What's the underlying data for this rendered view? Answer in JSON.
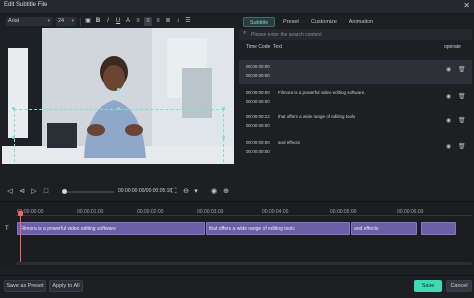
{
  "window": {
    "title": "Edit Subtitle File"
  },
  "toolbar": {
    "font": "Arial",
    "size": "24",
    "icons": [
      "bold-icon",
      "italic-icon",
      "underline-icon",
      "align-left-icon",
      "align-center-icon",
      "align-right-icon",
      "align-justify-icon",
      "text-style-icon",
      "color-icon"
    ]
  },
  "player": {
    "timecode": "00:00:00:00/00:00:05:16"
  },
  "tabs": [
    {
      "label": "Subtitle",
      "active": true
    },
    {
      "label": "Preset",
      "active": false
    },
    {
      "label": "Customize",
      "active": false
    },
    {
      "label": "Animation",
      "active": false
    }
  ],
  "search": {
    "placeholder": "Please enter the search content"
  },
  "list": {
    "header_time": "Time Code",
    "header_text": "Text",
    "header_op": "operate",
    "rows": [
      {
        "start": "00:00:00:00",
        "end": "00:00:00:00",
        "text": "",
        "selected": true
      },
      {
        "start": "00:00:00:00",
        "end": "00:00:00:00",
        "text": "Filmora is a powerful video editing software.",
        "selected": false
      },
      {
        "start": "00:00:00:22",
        "end": "00:00:00:00",
        "text": "that offers a wide range of editing tools",
        "selected": false
      },
      {
        "start": "00:00:00:00",
        "end": "00:00:00:00",
        "text": "and effects",
        "selected": false
      }
    ]
  },
  "timeline": {
    "ruler": [
      "00:00:00:00",
      "00:00:01:00",
      "00:00:02:00",
      "00:00:03:00",
      "00:00:04:00",
      "00:00:05:00",
      "00:00:06:00"
    ],
    "clips": [
      "Filmora is a powerful video editing software",
      "that offers a wide range of editing tools",
      "and effects",
      ""
    ]
  },
  "buttons": {
    "save_preset": "Save as Preset",
    "apply_all": "Apply to All",
    "save": "Save",
    "cancel": "Cancel"
  },
  "colors": {
    "accent": "#3fd9b4",
    "clip": "#6b5fa8",
    "playhead": "#ff5f5f"
  }
}
